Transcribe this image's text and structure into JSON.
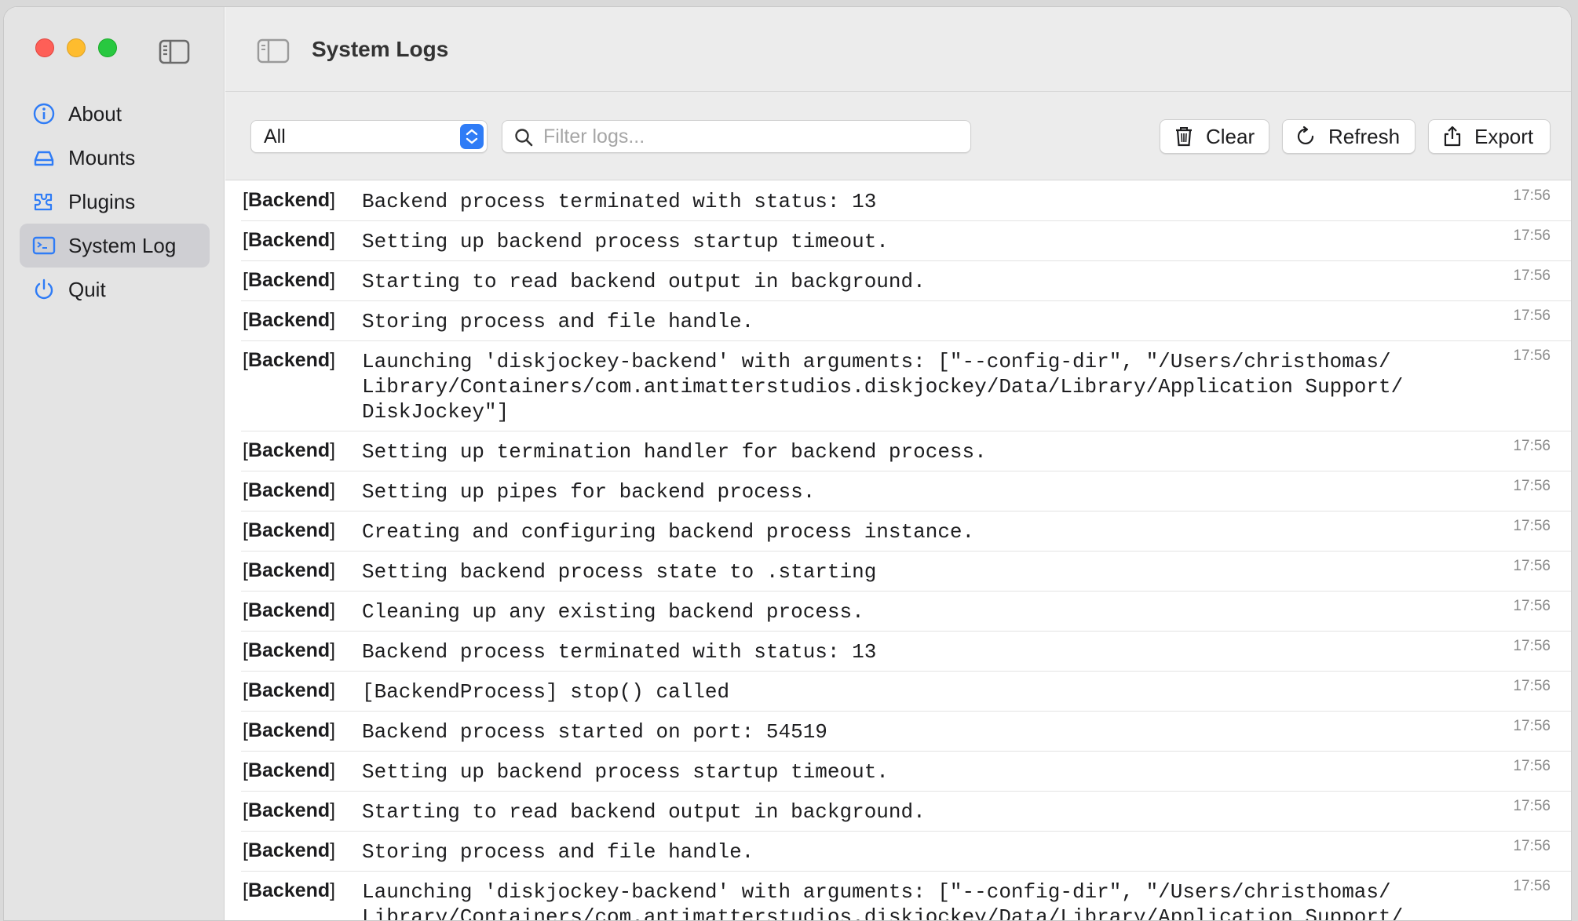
{
  "window": {
    "title": "System Logs"
  },
  "sidebar": {
    "items": [
      {
        "label": "About",
        "icon": "info-circle-icon",
        "selected": false
      },
      {
        "label": "Mounts",
        "icon": "drive-icon",
        "selected": false
      },
      {
        "label": "Plugins",
        "icon": "plugin-icon",
        "selected": false
      },
      {
        "label": "System Log",
        "icon": "terminal-icon",
        "selected": true
      },
      {
        "label": "Quit",
        "icon": "power-icon",
        "selected": false
      }
    ]
  },
  "toolbar": {
    "filter_select_value": "All",
    "search_placeholder": "Filter logs...",
    "search_value": "",
    "clear_label": "Clear",
    "refresh_label": "Refresh",
    "export_label": "Export"
  },
  "colors": {
    "accent": "#2f7cf6",
    "sidebar_bg": "#e4e4e4",
    "selected_item_bg": "#cfcfd3"
  },
  "logs": [
    {
      "source": "Backend",
      "message": "Backend process terminated with status: 13",
      "time": "17:56"
    },
    {
      "source": "Backend",
      "message": "Setting up backend process startup timeout.",
      "time": "17:56"
    },
    {
      "source": "Backend",
      "message": "Starting to read backend output in background.",
      "time": "17:56"
    },
    {
      "source": "Backend",
      "message": "Storing process and file handle.",
      "time": "17:56"
    },
    {
      "source": "Backend",
      "message": "Launching 'diskjockey-backend' with arguments: [\"--config-dir\", \"/Users/christhomas/\nLibrary/Containers/com.antimatterstudios.diskjockey/Data/Library/Application Support/\nDiskJockey\"]",
      "time": "17:56"
    },
    {
      "source": "Backend",
      "message": "Setting up termination handler for backend process.",
      "time": "17:56"
    },
    {
      "source": "Backend",
      "message": "Setting up pipes for backend process.",
      "time": "17:56"
    },
    {
      "source": "Backend",
      "message": "Creating and configuring backend process instance.",
      "time": "17:56"
    },
    {
      "source": "Backend",
      "message": "Setting backend process state to .starting",
      "time": "17:56"
    },
    {
      "source": "Backend",
      "message": "Cleaning up any existing backend process.",
      "time": "17:56"
    },
    {
      "source": "Backend",
      "message": "Backend process terminated with status: 13",
      "time": "17:56"
    },
    {
      "source": "Backend",
      "message": "[BackendProcess] stop() called",
      "time": "17:56"
    },
    {
      "source": "Backend",
      "message": "Backend process started on port: 54519",
      "time": "17:56"
    },
    {
      "source": "Backend",
      "message": "Setting up backend process startup timeout.",
      "time": "17:56"
    },
    {
      "source": "Backend",
      "message": "Starting to read backend output in background.",
      "time": "17:56"
    },
    {
      "source": "Backend",
      "message": "Storing process and file handle.",
      "time": "17:56"
    },
    {
      "source": "Backend",
      "message": "Launching 'diskjockey-backend' with arguments: [\"--config-dir\", \"/Users/christhomas/\nLibrary/Containers/com.antimatterstudios.diskjockey/Data/Library/Application Support/\nDiskJockey\"]",
      "time": "17:56"
    }
  ]
}
